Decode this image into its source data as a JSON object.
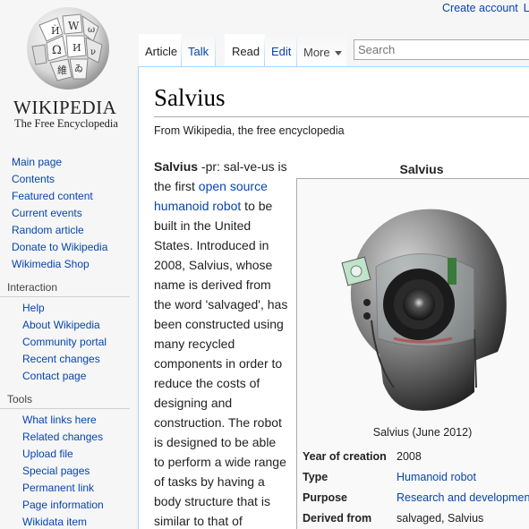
{
  "personal": {
    "create_account": "Create account",
    "login_initial": "L"
  },
  "logo": {
    "wordmark": "WIKIPEDIA",
    "tagline": "The Free Encyclopedia"
  },
  "navigation": {
    "items": [
      "Main page",
      "Contents",
      "Featured content",
      "Current events",
      "Random article",
      "Donate to Wikipedia",
      "Wikimedia Shop"
    ]
  },
  "interaction": {
    "heading": "Interaction",
    "items": [
      "Help",
      "About Wikipedia",
      "Community portal",
      "Recent changes",
      "Contact page"
    ]
  },
  "tools": {
    "heading": "Tools",
    "items": [
      "What links here",
      "Related changes",
      "Upload file",
      "Special pages",
      "Permanent link",
      "Page information",
      "Wikidata item"
    ]
  },
  "tabs": {
    "article": "Article",
    "talk": "Talk",
    "read": "Read",
    "edit": "Edit",
    "more": "More"
  },
  "search": {
    "placeholder": "Search"
  },
  "article": {
    "title": "Salvius",
    "tagline": "From Wikipedia, the free encyclopedia",
    "lead_bold": "Salvius",
    "lead_1": " -pr: sal-ve-us is the first ",
    "link_open_source": "open source",
    "lead_2": " ",
    "link_humanoid": "humanoid robot",
    "lead_3": " to be built in the United States. Introduced in 2008, Salvius, whose name is derived from the word 'salvaged', has been constructed using many recycled components in order to reduce the costs of designing and construction. The robot is designed to be able to perform a wide range of tasks by having a body structure that is similar to that of"
  },
  "infobox": {
    "title": "Salvius",
    "caption": "Salvius (June 2012)",
    "rows": [
      {
        "label": "Year of creation",
        "value": "2008"
      },
      {
        "label": "Type",
        "value": "Humanoid robot"
      },
      {
        "label": "Purpose",
        "value": "Research and development"
      },
      {
        "label": "Derived from",
        "value": "salvaged, Salvius"
      }
    ]
  },
  "colors": {
    "link": "#0645ad",
    "border": "#a7d7f9",
    "sidebar_bg": "#f6f6f6"
  }
}
